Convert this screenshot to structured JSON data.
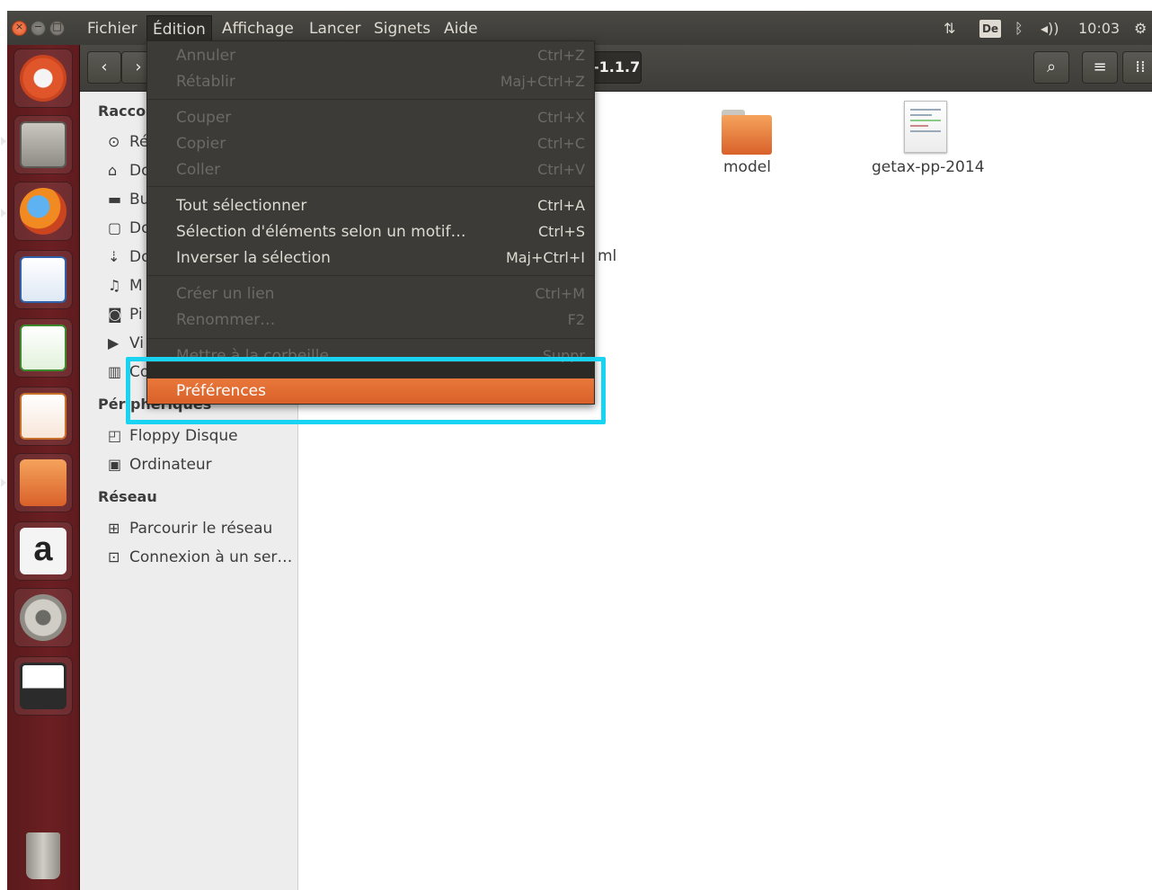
{
  "menubar": {
    "items": [
      "Fichier",
      "Édition",
      "Affichage",
      "Lancer",
      "Signets",
      "Aide"
    ],
    "active": "Édition"
  },
  "indicators": {
    "keyboard": "De",
    "clock": "10:03"
  },
  "toolbar": {
    "back": "‹",
    "forward": "›",
    "path_segment": "-1.1.7"
  },
  "sidebar": {
    "shortcuts_header": "Racco",
    "shortcuts": [
      {
        "icon": "recent-icon",
        "glyph": "⊙",
        "label": "Ré"
      },
      {
        "icon": "home-icon",
        "glyph": "⌂",
        "label": "Do"
      },
      {
        "icon": "desktop-folder-icon",
        "glyph": "▬",
        "label": "Bu"
      },
      {
        "icon": "document-icon",
        "glyph": "▢",
        "label": "Do"
      },
      {
        "icon": "download-icon",
        "glyph": "⇣",
        "label": "Do"
      },
      {
        "icon": "music-icon",
        "glyph": "♫",
        "label": "M"
      },
      {
        "icon": "camera-icon",
        "glyph": "◙",
        "label": "Pi"
      },
      {
        "icon": "video-icon",
        "glyph": "▶",
        "label": "Vi"
      },
      {
        "icon": "trash-icon",
        "glyph": "▥",
        "label": "Co"
      }
    ],
    "devices_header": "Périphériques",
    "devices": [
      {
        "icon": "floppy-icon",
        "glyph": "◰",
        "label": "Floppy Disque"
      },
      {
        "icon": "computer-icon",
        "glyph": "▣",
        "label": "Ordinateur"
      }
    ],
    "network_header": "Réseau",
    "network": [
      {
        "icon": "network-icon",
        "glyph": "⊞",
        "label": "Parcourir le réseau"
      },
      {
        "icon": "server-icon",
        "glyph": "⊡",
        "label": "Connexion à un ser…"
      }
    ]
  },
  "files": [
    {
      "name": "model",
      "kind": "folder"
    },
    {
      "name": "getax-pp-2014",
      "kind": "document"
    },
    {
      "name": "ml",
      "kind": "partial"
    }
  ],
  "edit_menu": [
    {
      "label": "Annuler",
      "shortcut": "Ctrl+Z",
      "state": "disabled"
    },
    {
      "label": "Rétablir",
      "shortcut": "Maj+Ctrl+Z",
      "state": "disabled"
    },
    {
      "label": "Couper",
      "shortcut": "Ctrl+X",
      "state": "disabled"
    },
    {
      "label": "Copier",
      "shortcut": "Ctrl+C",
      "state": "disabled"
    },
    {
      "label": "Coller",
      "shortcut": "Ctrl+V",
      "state": "disabled"
    },
    {
      "label": "Tout sélectionner",
      "shortcut": "Ctrl+A",
      "state": "enabled"
    },
    {
      "label": "Sélection d'éléments selon un motif…",
      "shortcut": "Ctrl+S",
      "state": "enabled"
    },
    {
      "label": "Inverser la sélection",
      "shortcut": "Maj+Ctrl+I",
      "state": "enabled"
    },
    {
      "label": "Créer un lien",
      "shortcut": "Ctrl+M",
      "state": "disabled"
    },
    {
      "label": "Renommer…",
      "shortcut": "F2",
      "state": "disabled"
    },
    {
      "label": "Mettre à la corbeille",
      "shortcut": "Suppr",
      "state": "disabled"
    },
    {
      "label": "Préférences",
      "shortcut": "",
      "state": "highlight"
    }
  ],
  "colors": {
    "accent": "#e9773a",
    "callout": "#18d4f2",
    "panel": "#3c3b37",
    "launcher": "#6b1f22"
  }
}
